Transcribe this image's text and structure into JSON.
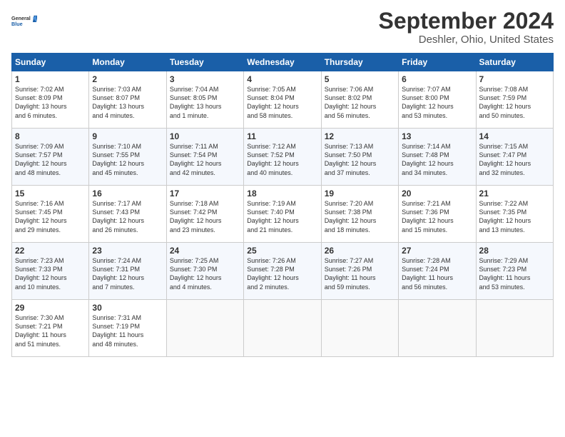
{
  "logo": {
    "line1": "General",
    "line2": "Blue"
  },
  "title": "September 2024",
  "location": "Deshler, Ohio, United States",
  "days_of_week": [
    "Sunday",
    "Monday",
    "Tuesday",
    "Wednesday",
    "Thursday",
    "Friday",
    "Saturday"
  ],
  "weeks": [
    [
      {
        "day": "1",
        "info": "Sunrise: 7:02 AM\nSunset: 8:09 PM\nDaylight: 13 hours\nand 6 minutes."
      },
      {
        "day": "2",
        "info": "Sunrise: 7:03 AM\nSunset: 8:07 PM\nDaylight: 13 hours\nand 4 minutes."
      },
      {
        "day": "3",
        "info": "Sunrise: 7:04 AM\nSunset: 8:05 PM\nDaylight: 13 hours\nand 1 minute."
      },
      {
        "day": "4",
        "info": "Sunrise: 7:05 AM\nSunset: 8:04 PM\nDaylight: 12 hours\nand 58 minutes."
      },
      {
        "day": "5",
        "info": "Sunrise: 7:06 AM\nSunset: 8:02 PM\nDaylight: 12 hours\nand 56 minutes."
      },
      {
        "day": "6",
        "info": "Sunrise: 7:07 AM\nSunset: 8:00 PM\nDaylight: 12 hours\nand 53 minutes."
      },
      {
        "day": "7",
        "info": "Sunrise: 7:08 AM\nSunset: 7:59 PM\nDaylight: 12 hours\nand 50 minutes."
      }
    ],
    [
      {
        "day": "8",
        "info": "Sunrise: 7:09 AM\nSunset: 7:57 PM\nDaylight: 12 hours\nand 48 minutes."
      },
      {
        "day": "9",
        "info": "Sunrise: 7:10 AM\nSunset: 7:55 PM\nDaylight: 12 hours\nand 45 minutes."
      },
      {
        "day": "10",
        "info": "Sunrise: 7:11 AM\nSunset: 7:54 PM\nDaylight: 12 hours\nand 42 minutes."
      },
      {
        "day": "11",
        "info": "Sunrise: 7:12 AM\nSunset: 7:52 PM\nDaylight: 12 hours\nand 40 minutes."
      },
      {
        "day": "12",
        "info": "Sunrise: 7:13 AM\nSunset: 7:50 PM\nDaylight: 12 hours\nand 37 minutes."
      },
      {
        "day": "13",
        "info": "Sunrise: 7:14 AM\nSunset: 7:48 PM\nDaylight: 12 hours\nand 34 minutes."
      },
      {
        "day": "14",
        "info": "Sunrise: 7:15 AM\nSunset: 7:47 PM\nDaylight: 12 hours\nand 32 minutes."
      }
    ],
    [
      {
        "day": "15",
        "info": "Sunrise: 7:16 AM\nSunset: 7:45 PM\nDaylight: 12 hours\nand 29 minutes."
      },
      {
        "day": "16",
        "info": "Sunrise: 7:17 AM\nSunset: 7:43 PM\nDaylight: 12 hours\nand 26 minutes."
      },
      {
        "day": "17",
        "info": "Sunrise: 7:18 AM\nSunset: 7:42 PM\nDaylight: 12 hours\nand 23 minutes."
      },
      {
        "day": "18",
        "info": "Sunrise: 7:19 AM\nSunset: 7:40 PM\nDaylight: 12 hours\nand 21 minutes."
      },
      {
        "day": "19",
        "info": "Sunrise: 7:20 AM\nSunset: 7:38 PM\nDaylight: 12 hours\nand 18 minutes."
      },
      {
        "day": "20",
        "info": "Sunrise: 7:21 AM\nSunset: 7:36 PM\nDaylight: 12 hours\nand 15 minutes."
      },
      {
        "day": "21",
        "info": "Sunrise: 7:22 AM\nSunset: 7:35 PM\nDaylight: 12 hours\nand 13 minutes."
      }
    ],
    [
      {
        "day": "22",
        "info": "Sunrise: 7:23 AM\nSunset: 7:33 PM\nDaylight: 12 hours\nand 10 minutes."
      },
      {
        "day": "23",
        "info": "Sunrise: 7:24 AM\nSunset: 7:31 PM\nDaylight: 12 hours\nand 7 minutes."
      },
      {
        "day": "24",
        "info": "Sunrise: 7:25 AM\nSunset: 7:30 PM\nDaylight: 12 hours\nand 4 minutes."
      },
      {
        "day": "25",
        "info": "Sunrise: 7:26 AM\nSunset: 7:28 PM\nDaylight: 12 hours\nand 2 minutes."
      },
      {
        "day": "26",
        "info": "Sunrise: 7:27 AM\nSunset: 7:26 PM\nDaylight: 11 hours\nand 59 minutes."
      },
      {
        "day": "27",
        "info": "Sunrise: 7:28 AM\nSunset: 7:24 PM\nDaylight: 11 hours\nand 56 minutes."
      },
      {
        "day": "28",
        "info": "Sunrise: 7:29 AM\nSunset: 7:23 PM\nDaylight: 11 hours\nand 53 minutes."
      }
    ],
    [
      {
        "day": "29",
        "info": "Sunrise: 7:30 AM\nSunset: 7:21 PM\nDaylight: 11 hours\nand 51 minutes."
      },
      {
        "day": "30",
        "info": "Sunrise: 7:31 AM\nSunset: 7:19 PM\nDaylight: 11 hours\nand 48 minutes."
      },
      {
        "day": "",
        "info": ""
      },
      {
        "day": "",
        "info": ""
      },
      {
        "day": "",
        "info": ""
      },
      {
        "day": "",
        "info": ""
      },
      {
        "day": "",
        "info": ""
      }
    ]
  ]
}
